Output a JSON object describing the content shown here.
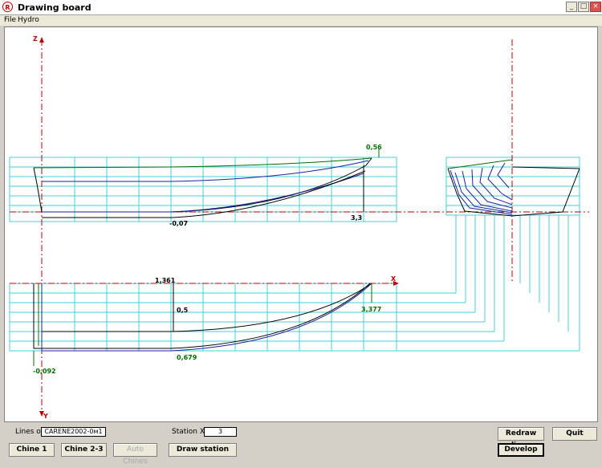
{
  "window": {
    "title": "Drawing board"
  },
  "menu": {
    "items": [
      "File",
      "Hydro"
    ]
  },
  "drawing": {
    "axis_z": "Z",
    "axis_x": "X",
    "axis_y": "Y",
    "annotations": {
      "freeboard_top": "0,56",
      "depth_bottom": "-0,07",
      "station_length": "3,3",
      "half_breadth": "1,361",
      "chine_value": "0,5",
      "bow_offset": "3,377",
      "keel_offset": "0,679",
      "stern_offset": "-0,092"
    },
    "colors": {
      "grid": "#40d0d8",
      "axis": "#c00000",
      "hull_blue": "#2020a0",
      "hull_green": "#007000",
      "hull_black": "#000000"
    }
  },
  "bottom": {
    "lines_of_label": "Lines of",
    "lines_of_value": "CARENE2002-0м1",
    "station_label": "Station X=",
    "station_value": "3",
    "chine1": "Chine 1",
    "chine23": "Chine 2-3",
    "auto_chines": "Auto Chines",
    "draw_station": "Draw station",
    "redraw": "Redraw lines",
    "quit": "Quit",
    "develop": "Develop"
  }
}
